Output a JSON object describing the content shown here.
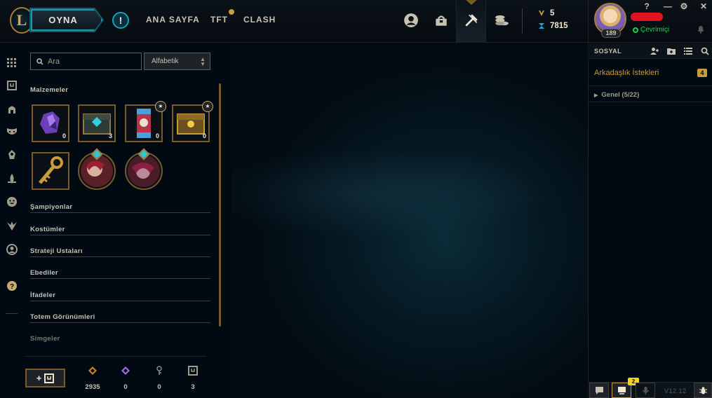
{
  "topbar": {
    "play_label": "OYNA",
    "alert_label": "!",
    "nav": [
      {
        "label": "ANA SAYFA"
      },
      {
        "label": "TFT"
      },
      {
        "label": "CLASH"
      }
    ],
    "currency": {
      "be": "5",
      "rp": "7815"
    }
  },
  "profile": {
    "level": "189",
    "status": "Çevrimiçi",
    "help": "?",
    "minimize": "—",
    "settings": "⚙",
    "close": "✕"
  },
  "loot": {
    "search_placeholder": "Ara",
    "sort_value": "Alfabetik",
    "materials_title": "Malzemeler",
    "items": [
      {
        "icon": "gemstone-icon",
        "count": "0"
      },
      {
        "icon": "hextech-chest-icon",
        "count": "3"
      },
      {
        "icon": "event-capsule-icon",
        "count": "0",
        "star": "★"
      },
      {
        "icon": "masterwork-chest-icon",
        "count": "0",
        "star": "★"
      },
      {
        "icon": "hextech-key-icon"
      },
      {
        "icon": "skin-orb-icon"
      },
      {
        "icon": "skin-orb-icon"
      }
    ],
    "sections": [
      "Şampiyonlar",
      "Kostümler",
      "Strateji Ustaları",
      "Ebediler",
      "İfadeler",
      "Totem Görünümleri",
      "Simgeler"
    ],
    "add_label": "+",
    "resources": [
      {
        "icon": "blue-essence-icon",
        "value": "2935",
        "color": "#c8821e"
      },
      {
        "icon": "mythic-essence-icon",
        "value": "0",
        "color": "#9b6ee0"
      },
      {
        "icon": "key-fragment-icon",
        "value": "0",
        "color": "#8c8c8c"
      },
      {
        "icon": "emote-token-icon",
        "value": "3",
        "color": "#a09b8c"
      }
    ]
  },
  "social": {
    "title": "SOSYAL",
    "friend_requests": "Arkadaşlık İstekleri",
    "friend_requests_count": "4",
    "group": "Genel (5/22)",
    "badge": "2",
    "version": "V12.12"
  },
  "colors": {
    "gold": "#c89b3c",
    "gold_dark": "#785a28",
    "teal": "#0ea5c0",
    "online": "#1bd44b",
    "bg": "#010a13"
  }
}
